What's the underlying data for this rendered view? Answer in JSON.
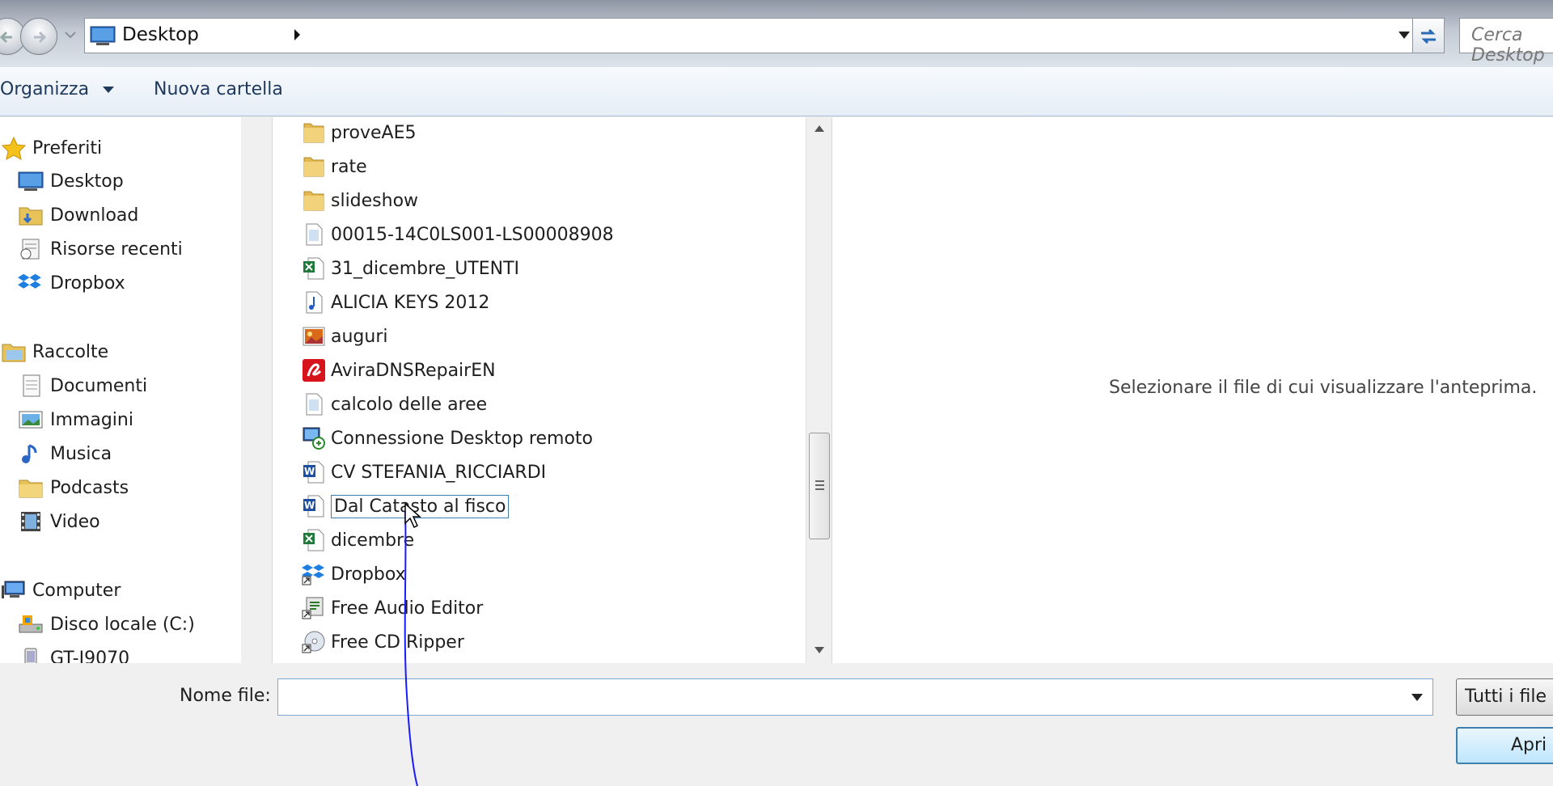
{
  "address_bar": {
    "location": "Desktop",
    "search_placeholder": "Cerca Desktop"
  },
  "toolbar": {
    "organize_label": "Organizza",
    "new_folder_label": "Nuova cartella"
  },
  "nav_pane": {
    "favorites": {
      "label": "Preferiti",
      "items": [
        "Desktop",
        "Download",
        "Risorse recenti",
        "Dropbox"
      ]
    },
    "libraries": {
      "label": "Raccolte",
      "items": [
        "Documenti",
        "Immagini",
        "Musica",
        "Podcasts",
        "Video"
      ]
    },
    "computer": {
      "label": "Computer",
      "items": [
        "Disco locale (C:)",
        "GT-I9070"
      ]
    }
  },
  "file_list": {
    "items": [
      {
        "name": "proveAE5",
        "icon": "folder-icon"
      },
      {
        "name": "rate",
        "icon": "folder-icon"
      },
      {
        "name": "slideshow",
        "icon": "folder-icon"
      },
      {
        "name": "00015-14C0LS001-LS00008908",
        "icon": "text-file-icon"
      },
      {
        "name": "31_dicembre_UTENTI",
        "icon": "excel-icon"
      },
      {
        "name": "ALICIA KEYS 2012",
        "icon": "music-file-icon"
      },
      {
        "name": "auguri",
        "icon": "image-file-icon"
      },
      {
        "name": "AviraDNSRepairEN",
        "icon": "avira-icon"
      },
      {
        "name": "calcolo delle aree",
        "icon": "text-file-icon"
      },
      {
        "name": "Connessione Desktop remoto",
        "icon": "remote-desktop-icon"
      },
      {
        "name": "CV STEFANIA_RICCIARDI",
        "icon": "word-icon"
      },
      {
        "name": "Dal Catasto al fisco",
        "icon": "word-icon",
        "selected": true
      },
      {
        "name": "dicembre",
        "icon": "excel-icon"
      },
      {
        "name": "Dropbox",
        "icon": "dropbox-shortcut-icon"
      },
      {
        "name": "Free Audio Editor",
        "icon": "app-shortcut-icon"
      },
      {
        "name": "Free CD Ripper",
        "icon": "cd-shortcut-icon"
      }
    ]
  },
  "preview": {
    "message": "Selezionare il file di cui visualizzare l'anteprima."
  },
  "bottom": {
    "filename_label": "Nome file:",
    "filename_value": "",
    "filter_value": "Tutti i file (*.*)",
    "open_label": "Apri"
  },
  "colors": {
    "accent": "#3c7fb1",
    "toolbar_text": "#1e395b",
    "selection": "#84acdd",
    "drag_line": "#1a1aff"
  }
}
